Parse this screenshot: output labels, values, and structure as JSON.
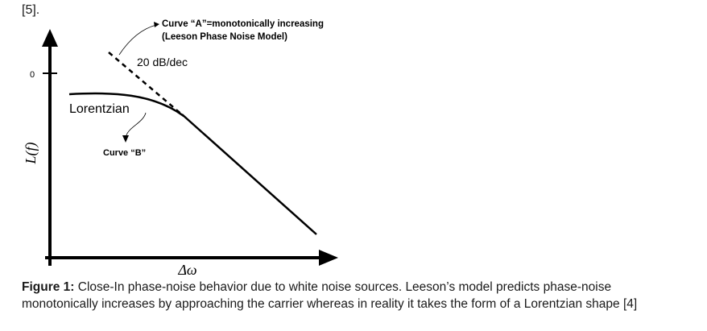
{
  "header": {
    "ref": "[5]."
  },
  "figure": {
    "curve_a_line1": "Curve “A”=monotonically increasing",
    "curve_a_line2": "(Leeson Phase Noise Model)",
    "slope_label": "20 dB/dec",
    "y_tick_zero": "0",
    "lorentzian_label": "Lorentzian",
    "curve_b_label": "Curve “B”",
    "y_axis_label": "L(f)",
    "x_axis_label": "Δω"
  },
  "caption": {
    "label": "Figure 1:",
    "text": " Close-In phase-noise behavior due to white noise sources. Leeson’s model predicts phase-noise monotonically increases by approaching the carrier whereas in reality it takes the form of a Lorentzian shape [4]"
  }
}
